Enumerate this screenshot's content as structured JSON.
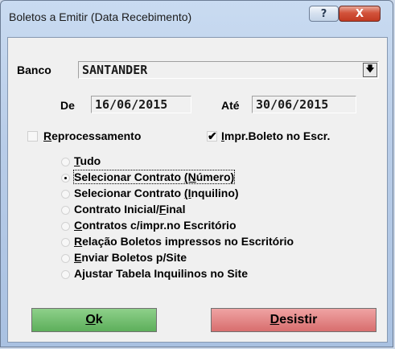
{
  "window": {
    "title": "Boletos a Emitir (Data Recebimento)",
    "help_glyph": "?",
    "close_glyph": "X"
  },
  "banco": {
    "label": "Banco",
    "value": "SANTANDER",
    "dropdown_icon": "dropdown-arrow-icon"
  },
  "dates": {
    "from_label": "De",
    "from_value": "16/06/2015",
    "to_label": "Até",
    "to_value": "30/06/2015"
  },
  "checks": {
    "reprocess": {
      "accel": "R",
      "rest": "eprocessamento",
      "checked": false
    },
    "impr_escr": {
      "accel": "I",
      "rest": "mpr.Boleto no Escr.",
      "checked": true
    }
  },
  "options": {
    "selected_index": 1,
    "items": [
      {
        "pre": "",
        "accel": "T",
        "post": "udo"
      },
      {
        "pre": "Selecionar Contrato ",
        "accel": "(N",
        "post": "úmero)"
      },
      {
        "pre": "Selecionar Contrato ",
        "accel": "(I",
        "post": "nquilino)"
      },
      {
        "pre": "Contrato Inicial/",
        "accel": "F",
        "post": "inal"
      },
      {
        "pre": "",
        "accel": "C",
        "post": "ontratos c/impr.no Escritório"
      },
      {
        "pre": "",
        "accel": "R",
        "post": "elação Boletos impressos no Escritório"
      },
      {
        "pre": "",
        "accel": "E",
        "post": "nviar Boletos p/Site"
      },
      {
        "pre": "",
        "accel": "",
        "post": "Ajustar Tabela Inquilinos no Site"
      }
    ]
  },
  "buttons": {
    "ok": {
      "accel": "O",
      "rest": "k",
      "color": "#6cbf69"
    },
    "cancel": {
      "accel": "D",
      "rest": "esistir",
      "color": "#e28080"
    }
  }
}
